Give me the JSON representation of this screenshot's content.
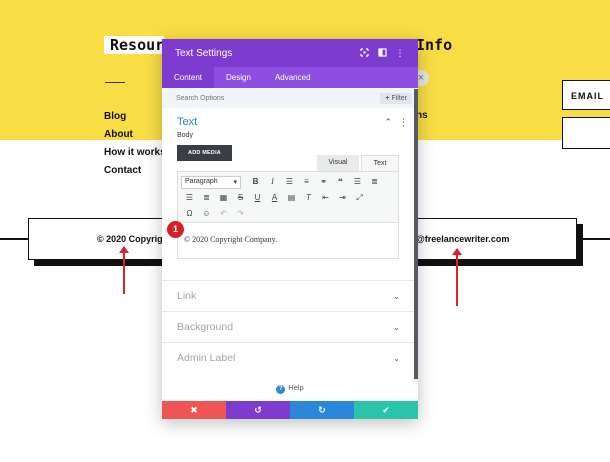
{
  "background_page": {
    "heading_left": "Resources",
    "heading_right": "Info",
    "nav_items": [
      "Blog",
      "About",
      "How it works",
      "Contact"
    ],
    "nav_right_fragment": "ns",
    "email_button": "EMAIL",
    "footer_left": "© 2020 Copyright Company.",
    "footer_right": "@freelancewriter.com"
  },
  "modal": {
    "title": "Text Settings",
    "header_icons": [
      "expand-icon",
      "split-view-icon",
      "more-icon"
    ],
    "tabs": [
      {
        "label": "Content",
        "active": true
      },
      {
        "label": "Design",
        "active": false
      },
      {
        "label": "Advanced",
        "active": false
      }
    ],
    "search_placeholder": "Search Options",
    "filter_label": "Filter",
    "text_section": {
      "title": "Text",
      "body_label": "Body",
      "add_media_label": "ADD MEDIA",
      "editor_tabs": {
        "visual": "Visual",
        "text": "Text"
      },
      "format_select": "Paragraph",
      "content": "© 2020 Copyright Company.",
      "badge": "1"
    },
    "collapsed_sections": [
      "Link",
      "Background",
      "Admin Label"
    ],
    "help_label": "Help"
  },
  "colors": {
    "header_purple": "#7e3bd0",
    "tabs_purple": "#8e4fe0",
    "accent_blue": "#2b87da",
    "discard_red": "#ef5555",
    "save_green": "#29c4a9",
    "page_yellow": "#f8dd45",
    "annotation_red": "#d9222a"
  }
}
